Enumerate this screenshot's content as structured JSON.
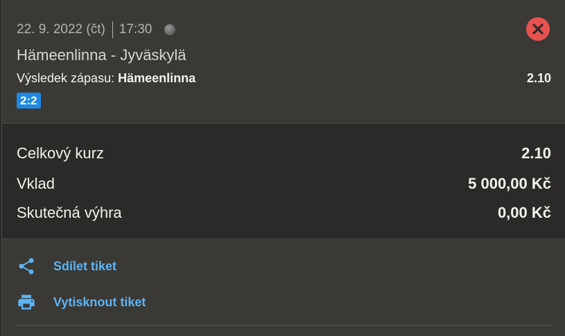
{
  "bet": {
    "date": "22. 9. 2022 (čt)",
    "time": "17:30",
    "match": "Hämeenlinna - Jyväskylä",
    "market_label": "Výsledek zápasu:",
    "selection": "Hämeenlinna",
    "odds": "2.10",
    "score": "2:2",
    "status_icon": "grey-dot-icon"
  },
  "close": {
    "icon": "close-icon",
    "color": "#e8524f"
  },
  "summary": {
    "total_odds_label": "Celkový kurz",
    "total_odds_value": "2.10",
    "stake_label": "Vklad",
    "stake_value": "5 000,00 Kč",
    "win_label": "Skutečná výhra",
    "win_value": "0,00 Kč"
  },
  "actions": {
    "share_label": "Sdílet tiket",
    "share_icon": "share-icon",
    "print_label": "Vytisknout tiket",
    "print_icon": "printer-icon",
    "accent": "#5eb3f2"
  }
}
